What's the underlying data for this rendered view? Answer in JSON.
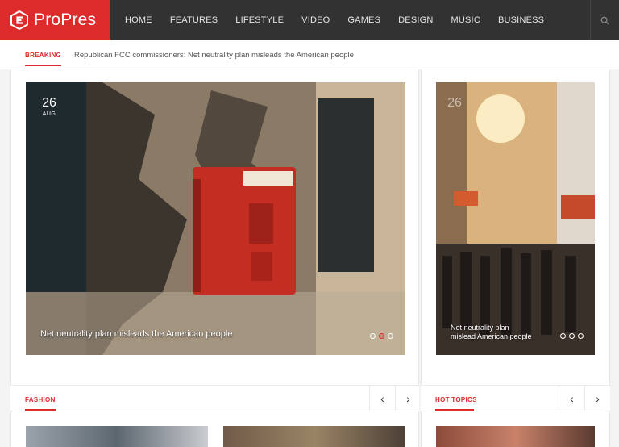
{
  "brand": {
    "name": "ProPres",
    "accent": "#dd2a2a",
    "header_bg": "#323232"
  },
  "nav": {
    "items": [
      "HOME",
      "FEATURES",
      "LIFESTYLE",
      "VIDEO",
      "GAMES",
      "DESIGN",
      "MUSIC",
      "BUSINESS"
    ],
    "search_icon": "search-icon"
  },
  "breaking": {
    "label": "BREAKING",
    "headline": "Republican FCC commissioners: Net neutrality plan misleads the American people"
  },
  "slides": {
    "main": {
      "day": "26",
      "month": "AUG",
      "title": "Net neutrality plan misleads the American people",
      "active_dot": 1
    },
    "side": {
      "day": "26",
      "title_line1": "Net neutrality plan",
      "title_line2": "mislead American people",
      "active_dot": 0
    }
  },
  "sections": {
    "fashion": {
      "label": "FASHION",
      "prev_icon": "chevron-left-icon",
      "next_icon": "chevron-right-icon"
    },
    "hot_topics": {
      "label": "HOT TOPICS",
      "prev_icon": "chevron-left-icon",
      "next_icon": "chevron-right-icon"
    }
  },
  "arrows": {
    "prev": "‹",
    "next": "›"
  }
}
